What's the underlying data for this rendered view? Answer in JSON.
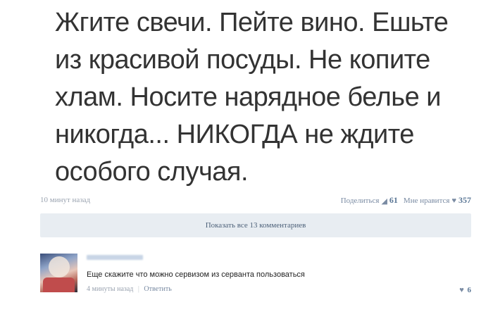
{
  "post": {
    "text_lines": [
      "Жгите свечи. Пейте вино. Ешьте",
      "из красивой посуды. Не копите",
      "хлам. Носите нарядное белье и",
      "никогда... НИКОГДА не ждите",
      "особого случая."
    ],
    "timestamp": "10 минут назад",
    "share_label": "Поделиться",
    "share_count": "61",
    "like_label": "Мне нравится",
    "like_count": "357"
  },
  "show_comments_label": "Показать все 13 комментариев",
  "comment": {
    "text": "Еще скажите что можно сервизом из серванта пользоваться",
    "timestamp": "4 минуты назад",
    "separator": "|",
    "reply_label": "Ответить",
    "like_count": "6"
  },
  "icons": {
    "share": "share-icon",
    "heart": "heart-icon"
  },
  "colors": {
    "link": "#7a8ba3",
    "count": "#5b7796",
    "button_bg": "#e8edf2"
  }
}
